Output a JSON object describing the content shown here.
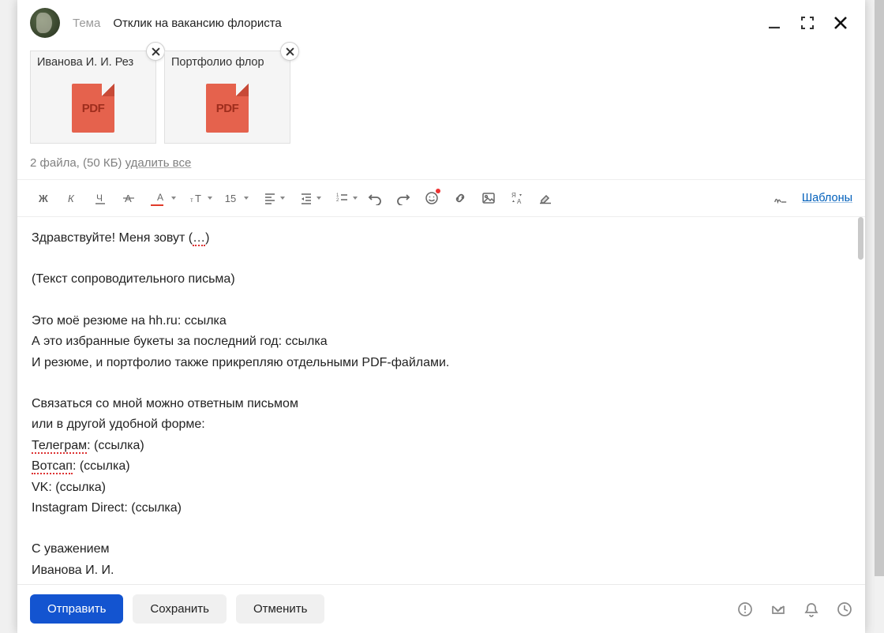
{
  "header": {
    "subject_label": "Тема",
    "subject_value": "Отклик на вакансию флориста"
  },
  "attachments": {
    "items": [
      {
        "name": "Иванова И. И. Рез",
        "type_label": "PDF"
      },
      {
        "name": "Портфолио флор",
        "type_label": "PDF"
      }
    ],
    "summary_prefix": "2 файла, (50 КБ) ",
    "delete_all": "удалить все"
  },
  "toolbar": {
    "font_size": "15",
    "signature_label": "",
    "templates_label": "Шаблоны"
  },
  "body": {
    "line1_a": "Здравствуйте! Меня зовут (",
    "line1_b": "…",
    "line1_c": ")",
    "line2": "(Текст сопроводительного письма)",
    "line3": "Это моё резюме на hh.ru: ссылка",
    "line4": "А это избранные букеты за последний год: ссылка",
    "line5": "И резюме, и портфолио также прикрепляю отдельными PDF-файлами.",
    "line6": "Связаться со мной можно ответным письмом",
    "line7": "или в другой удобной форме:",
    "line8_a": "Телеграм",
    "line8_b": ": (ссылка)",
    "line9_a": "Вотсап",
    "line9_b": ": (ссылка)",
    "line10": "VK: (ссылка)",
    "line11": "Instagram Direct: (ссылка)",
    "line12": "С уважением",
    "line13": "Иванова И. И."
  },
  "footer": {
    "send": "Отправить",
    "save": "Сохранить",
    "cancel": "Отменить"
  }
}
